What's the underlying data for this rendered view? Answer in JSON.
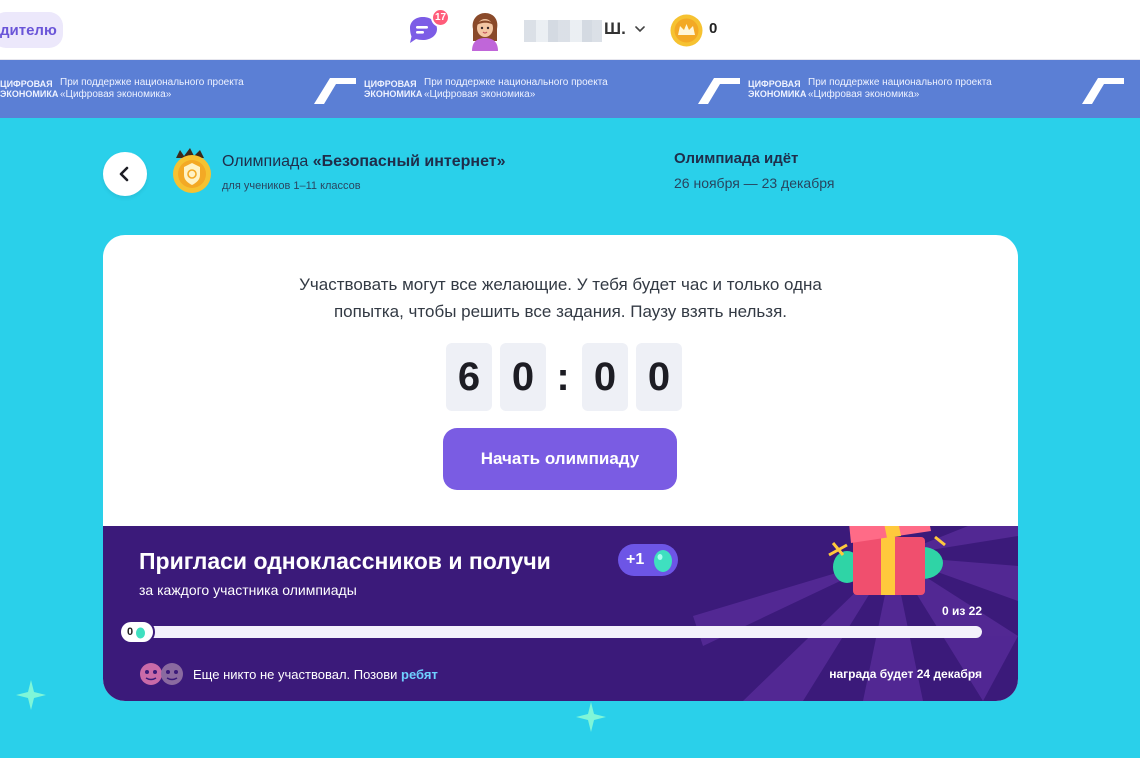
{
  "header": {
    "parent_button_label": "дителю",
    "chat_badge": "17",
    "user_name_suffix": "Ш.",
    "coins": "0"
  },
  "banner": {
    "program_name": "ЦИФРОВАЯ ЭКОНОМИКА",
    "support_text": "При поддержке национального проекта «Цифровая экономика»"
  },
  "olympiad": {
    "back_label": "‹",
    "title_prefix": "Олимпиада ",
    "title_name": "«Безопасный интернет»",
    "audience": "для учеников 1–11 классов",
    "status": "Олимпиада идёт",
    "dates": "26 ноября — 23 декабря"
  },
  "card": {
    "description_line1": "Участвовать могут все желающие. У тебя будет час и только одна",
    "description_line2": "попытка, чтобы решить все задания. Паузу взять нельзя.",
    "timer": {
      "d1": "6",
      "d2": "0",
      "sep": ":",
      "d3": "0",
      "d4": "0"
    },
    "start_button": "Начать олимпиаду"
  },
  "invite": {
    "title": "Пригласи одноклассников и получи",
    "bonus": "+1",
    "subtitle": "за каждого участника олимпиады",
    "progress_current": "0",
    "progress_label": "0 из 22",
    "progress_value": 0,
    "progress_max": 22,
    "participants_text": "Еще никто не участвовал. Позови ",
    "participants_link": "ребят",
    "reward_text": "награда будет 24 декабря"
  },
  "colors": {
    "main_bg": "#2ad0ea",
    "banner_bg": "#5b7fd5",
    "accent": "#7a5ce3",
    "invite_bg": "#3b1a7a"
  }
}
